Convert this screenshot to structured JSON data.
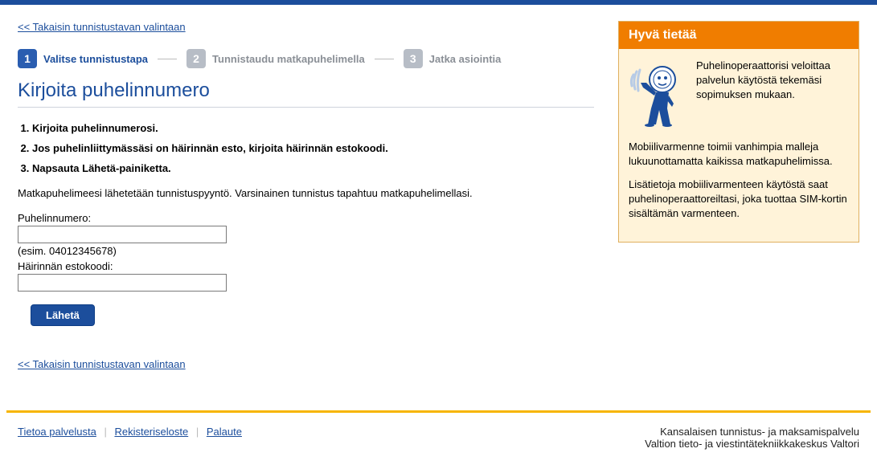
{
  "back_link_text": "<< Takaisin tunnistustavan valintaan",
  "steps": [
    {
      "num": "1",
      "label": "Valitse tunnistustapa",
      "active": true
    },
    {
      "num": "2",
      "label": "Tunnistaudu matkapuhelimella",
      "active": false
    },
    {
      "num": "3",
      "label": "Jatka asiointia",
      "active": false
    }
  ],
  "page_title": "Kirjoita puhelinnumero",
  "instructions": [
    "Kirjoita puhelinnumerosi.",
    "Jos puhelinliittymässäsi on häirinnän esto, kirjoita häirinnän estokoodi.",
    "Napsauta Lähetä-painiketta."
  ],
  "description": "Matkapuhelimeesi lähetetään tunnistuspyyntö. Varsinainen tunnistus tapahtuu matkapuhelimellasi.",
  "phone_label": "Puhelinnumero:",
  "phone_example": "(esim. 04012345678)",
  "block_label": "Häirinnän estokoodi:",
  "submit_label": "Lähetä",
  "sidebar": {
    "title": "Hyvä tietää",
    "p1": "Puhelinoperaattorisi veloittaa palvelun käytöstä tekemäsi sopimuksen mukaan.",
    "p2": "Mobiilivarmenne toimii vanhimpia malleja lukuunottamatta kaikissa matkapuhelimissa.",
    "p3": "Lisätietoja mobiilivarmenteen käytöstä saat puhelinoperaattoreiltasi, joka tuottaa SIM-kortin sisältämän varmenteen."
  },
  "footer": {
    "links": [
      "Tietoa palvelusta",
      "Rekisteriseloste",
      "Palaute"
    ],
    "right1": "Kansalaisen tunnistus- ja maksamispalvelu",
    "right2": "Valtion tieto- ja viestintätekniikkakeskus Valtori"
  }
}
